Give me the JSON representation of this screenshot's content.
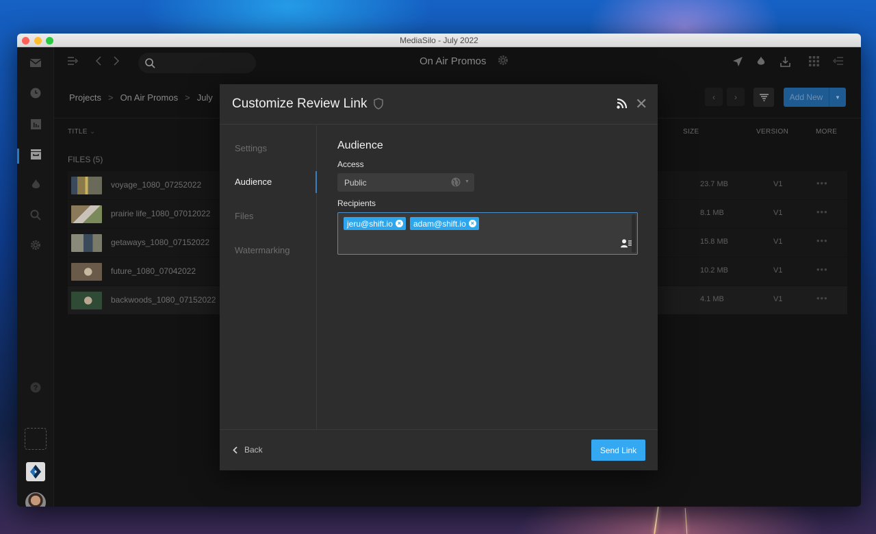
{
  "window": {
    "title": "MediaSilo - July 2022"
  },
  "topbar": {
    "project_title": "On Air Promos",
    "search_placeholder": ""
  },
  "breadcrumb": [
    "Projects",
    "On Air Promos",
    "July"
  ],
  "toolbar": {
    "add_new_label": "Add New"
  },
  "table": {
    "columns": {
      "title": "TITLE",
      "size": "SIZE",
      "version": "VERSION",
      "more": "MORE"
    },
    "files_label": "FILES (5)",
    "rows": [
      {
        "name": "voyage_1080_07252022",
        "size": "23.7 MB",
        "version": "V1",
        "more": "•••"
      },
      {
        "name": "prairie life_1080_07012022",
        "size": "8.1 MB",
        "version": "V1",
        "more": "•••"
      },
      {
        "name": "getaways_1080_07152022",
        "size": "15.8 MB",
        "version": "V1",
        "more": "•••"
      },
      {
        "name": "future_1080_07042022",
        "size": "10.2 MB",
        "version": "V1",
        "more": "•••"
      },
      {
        "name": "backwoods_1080_07152022",
        "size": "4.1 MB",
        "version": "V1",
        "more": "•••"
      }
    ]
  },
  "modal": {
    "title": "Customize Review Link",
    "nav": [
      "Settings",
      "Audience",
      "Files",
      "Watermarking"
    ],
    "active_nav": "Audience",
    "section_title": "Audience",
    "access_label": "Access",
    "access_value": "Public",
    "recipients_label": "Recipients",
    "recipients": [
      "jeru@shift.io",
      "adam@shift.io"
    ],
    "back_label": "Back",
    "send_label": "Send Link"
  },
  "colors": {
    "accent": "#34a8f0",
    "chip": "#2ea6ee",
    "add_new": "#1e5b92"
  }
}
